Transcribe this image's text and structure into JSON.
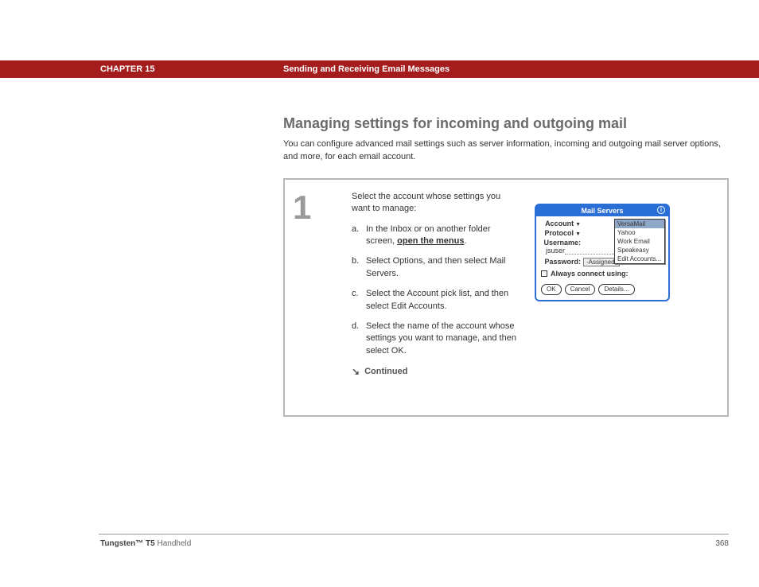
{
  "header": {
    "chapter": "CHAPTER 15",
    "title": "Sending and Receiving Email Messages"
  },
  "section": {
    "heading": "Managing settings for incoming and outgoing mail",
    "intro": "You can configure advanced mail settings such as server information, incoming and outgoing mail server options, and more, for each email account."
  },
  "step": {
    "number": "1",
    "lead": "Select the account whose settings you want to manage:",
    "sub": {
      "a_letter": "a.",
      "a_pre": "In the Inbox or on another folder screen, ",
      "a_link": "open the menus",
      "a_post": ".",
      "b_letter": "b.",
      "b_text": "Select Options, and then select Mail Servers.",
      "c_letter": "c.",
      "c_text": "Select the Account pick list, and then select Edit Accounts.",
      "d_letter": "d.",
      "d_text": "Select the name of the account whose settings you want to manage, and then select OK."
    },
    "continued": "Continued"
  },
  "figure": {
    "title": "Mail Servers",
    "info_glyph": "i",
    "labels": {
      "account": "Account",
      "protocol": "Protocol",
      "username": "Username:",
      "username_value": "jsuser",
      "password": "Password:",
      "assigned": "-Assigned-",
      "always": "Always connect using:"
    },
    "dropdown": {
      "selected": "VersaMail",
      "opt1": "Yahoo",
      "opt2": "Work Email",
      "opt3": "Speakeasy",
      "opt4": "Edit Accounts..."
    },
    "buttons": {
      "ok": "OK",
      "cancel": "Cancel",
      "details": "Details..."
    }
  },
  "footer": {
    "product_bold": "Tungsten™ T5",
    "product_rest": " Handheld",
    "page": "368"
  }
}
